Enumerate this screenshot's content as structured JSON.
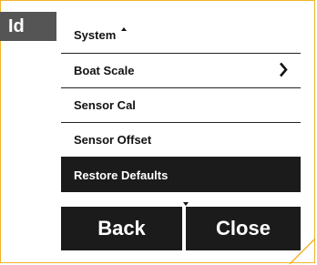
{
  "page_tag": "Id",
  "menu": {
    "items": [
      {
        "label": "System"
      },
      {
        "label": "Boat Scale",
        "has_submenu": true
      },
      {
        "label": "Sensor Cal"
      },
      {
        "label": "Sensor Offset"
      },
      {
        "label": "Restore Defaults",
        "selected": true
      }
    ]
  },
  "buttons": {
    "back_label": "Back",
    "close_label": "Close"
  },
  "colors": {
    "frame_border": "#f0b429",
    "tag_background": "#555555",
    "selected_background": "#1b1b1b"
  },
  "icons": {
    "submenu": "chevron-right-icon",
    "scroll_up": "scroll-up-arrow-icon",
    "scroll_down": "scroll-down-arrow-icon"
  }
}
